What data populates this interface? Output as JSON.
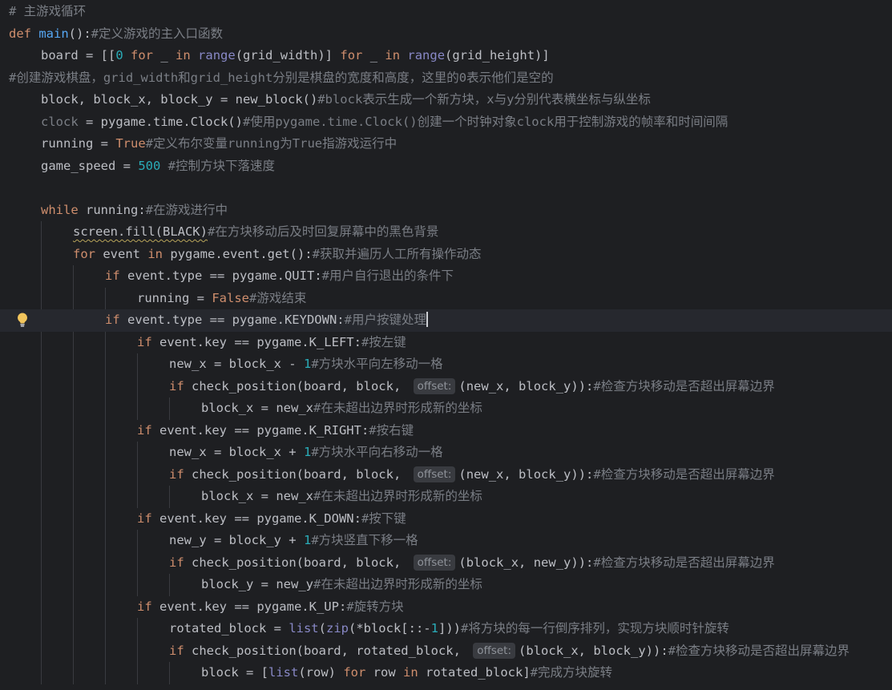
{
  "editor": {
    "theme": {
      "background": "#1e1f22",
      "current_line": "#26282e",
      "default_text": "#bcbec4",
      "comment": "#7a7e85",
      "keyword": "#cf8e6d",
      "function": "#56a8f5",
      "number": "#2aacb8",
      "builtin": "#8888c6",
      "hint_bg": "#393b40"
    },
    "gutter_icon": "lightbulb-icon",
    "lines": [
      {
        "indent": 0,
        "tokens": [
          {
            "t": "# 主游戏循环",
            "c": "cmt"
          }
        ]
      },
      {
        "indent": 0,
        "tokens": [
          {
            "t": "def",
            "c": "kw"
          },
          {
            "t": " "
          },
          {
            "t": "main",
            "c": "fn"
          },
          {
            "t": "():"
          },
          {
            "t": "#定义游戏的主入口函数",
            "c": "cmt"
          }
        ]
      },
      {
        "indent": 1,
        "tokens": [
          {
            "t": "board = [["
          },
          {
            "t": "0",
            "c": "num"
          },
          {
            "t": " "
          },
          {
            "t": "for",
            "c": "kw"
          },
          {
            "t": " _ "
          },
          {
            "t": "in",
            "c": "kw"
          },
          {
            "t": " "
          },
          {
            "t": "range",
            "c": "bi"
          },
          {
            "t": "(grid_width)] "
          },
          {
            "t": "for",
            "c": "kw"
          },
          {
            "t": " _ "
          },
          {
            "t": "in",
            "c": "kw"
          },
          {
            "t": " "
          },
          {
            "t": "range",
            "c": "bi"
          },
          {
            "t": "(grid_height)]"
          }
        ]
      },
      {
        "indent": 0,
        "tokens": [
          {
            "t": "#创建游戏棋盘，grid_width和grid_height分别是棋盘的宽度和高度，这里的0表示他们是空的",
            "c": "cmt"
          }
        ]
      },
      {
        "indent": 1,
        "tokens": [
          {
            "t": "block, block_x, block_y = new_block()"
          },
          {
            "t": "#block表示生成一个新方块，x与y分别代表横坐标与纵坐标",
            "c": "cmt"
          }
        ]
      },
      {
        "indent": 1,
        "tokens": [
          {
            "t": "clock",
            "c": "unused"
          },
          {
            "t": " = pygame.time.Clock()"
          },
          {
            "t": "#使用pygame.time.Clock()创建一个时钟对象clock用于控制游戏的帧率和时间间隔",
            "c": "cmt"
          }
        ]
      },
      {
        "indent": 1,
        "tokens": [
          {
            "t": "running = "
          },
          {
            "t": "True",
            "c": "kw"
          },
          {
            "t": "#定义布尔变量running为True指游戏运行中",
            "c": "cmt"
          }
        ]
      },
      {
        "indent": 1,
        "tokens": [
          {
            "t": "game_speed = "
          },
          {
            "t": "500",
            "c": "num"
          },
          {
            "t": " "
          },
          {
            "t": "#控制方块下落速度",
            "c": "cmt"
          }
        ]
      },
      {
        "indent": 0,
        "tokens": []
      },
      {
        "indent": 1,
        "tokens": [
          {
            "t": "while",
            "c": "kw"
          },
          {
            "t": " running:"
          },
          {
            "t": "#在游戏进行中",
            "c": "cmt"
          }
        ]
      },
      {
        "indent": 2,
        "tokens": [
          {
            "t": "screen.fill(BLACK)",
            "c": "warn"
          },
          {
            "t": "#在方块移动后及时回复屏幕中的黑色背景",
            "c": "cmt"
          }
        ]
      },
      {
        "indent": 2,
        "tokens": [
          {
            "t": "for",
            "c": "kw"
          },
          {
            "t": " event "
          },
          {
            "t": "in",
            "c": "kw"
          },
          {
            "t": " pygame.event.get():"
          },
          {
            "t": "#获取并遍历人工所有操作动态",
            "c": "cmt"
          }
        ]
      },
      {
        "indent": 3,
        "tokens": [
          {
            "t": "if",
            "c": "kw"
          },
          {
            "t": " event.type == pygame.QUIT:"
          },
          {
            "t": "#用户自行退出的条件下",
            "c": "cmt"
          }
        ]
      },
      {
        "indent": 4,
        "tokens": [
          {
            "t": "running = "
          },
          {
            "t": "False",
            "c": "kw"
          },
          {
            "t": "#游戏结束",
            "c": "cmt"
          }
        ]
      },
      {
        "indent": 3,
        "current": true,
        "caret": true,
        "bulb": true,
        "tokens": [
          {
            "t": "if",
            "c": "kw"
          },
          {
            "t": " event.type == pygame.KEYDOWN:"
          },
          {
            "t": "#用户按键处理",
            "c": "cmt"
          }
        ]
      },
      {
        "indent": 4,
        "tokens": [
          {
            "t": "if",
            "c": "kw"
          },
          {
            "t": " event.key == pygame.K_LEFT:"
          },
          {
            "t": "#按左键",
            "c": "cmt"
          }
        ]
      },
      {
        "indent": 5,
        "tokens": [
          {
            "t": "new_x = block_x - "
          },
          {
            "t": "1",
            "c": "num"
          },
          {
            "t": "#方块水平向左移动一格",
            "c": "cmt"
          }
        ]
      },
      {
        "indent": 5,
        "tokens": [
          {
            "t": "if",
            "c": "kw"
          },
          {
            "t": " check_position(board, block, "
          },
          {
            "t": "offset:",
            "c": "hint"
          },
          {
            "t": "(new_x, block_y)):"
          },
          {
            "t": "#检查方块移动是否超出屏幕边界",
            "c": "cmt"
          }
        ]
      },
      {
        "indent": 6,
        "tokens": [
          {
            "t": "block_x = new_x"
          },
          {
            "t": "#在未超出边界时形成新的坐标",
            "c": "cmt"
          }
        ]
      },
      {
        "indent": 4,
        "tokens": [
          {
            "t": "if",
            "c": "kw"
          },
          {
            "t": " event.key == pygame.K_RIGHT:"
          },
          {
            "t": "#按右键",
            "c": "cmt"
          }
        ]
      },
      {
        "indent": 5,
        "tokens": [
          {
            "t": "new_x = block_x + "
          },
          {
            "t": "1",
            "c": "num"
          },
          {
            "t": "#方块水平向右移动一格",
            "c": "cmt"
          }
        ]
      },
      {
        "indent": 5,
        "tokens": [
          {
            "t": "if",
            "c": "kw"
          },
          {
            "t": " check_position(board, block, "
          },
          {
            "t": "offset:",
            "c": "hint"
          },
          {
            "t": "(new_x, block_y)):"
          },
          {
            "t": "#检查方块移动是否超出屏幕边界",
            "c": "cmt"
          }
        ]
      },
      {
        "indent": 6,
        "tokens": [
          {
            "t": "block_x = new_x"
          },
          {
            "t": "#在未超出边界时形成新的坐标",
            "c": "cmt"
          }
        ]
      },
      {
        "indent": 4,
        "tokens": [
          {
            "t": "if",
            "c": "kw"
          },
          {
            "t": " event.key == pygame.K_DOWN:"
          },
          {
            "t": "#按下键",
            "c": "cmt"
          }
        ]
      },
      {
        "indent": 5,
        "tokens": [
          {
            "t": "new_y = block_y + "
          },
          {
            "t": "1",
            "c": "num"
          },
          {
            "t": "#方块竖直下移一格",
            "c": "cmt"
          }
        ]
      },
      {
        "indent": 5,
        "tokens": [
          {
            "t": "if",
            "c": "kw"
          },
          {
            "t": " check_position(board, block, "
          },
          {
            "t": "offset:",
            "c": "hint"
          },
          {
            "t": "(block_x, new_y)):"
          },
          {
            "t": "#检查方块移动是否超出屏幕边界",
            "c": "cmt"
          }
        ]
      },
      {
        "indent": 6,
        "tokens": [
          {
            "t": "block_y = new_y"
          },
          {
            "t": "#在未超出边界时形成新的坐标",
            "c": "cmt"
          }
        ]
      },
      {
        "indent": 4,
        "tokens": [
          {
            "t": "if",
            "c": "kw"
          },
          {
            "t": " event.key == pygame.K_UP:"
          },
          {
            "t": "#旋转方块",
            "c": "cmt"
          }
        ]
      },
      {
        "indent": 5,
        "tokens": [
          {
            "t": "rotated_block = "
          },
          {
            "t": "list",
            "c": "bi"
          },
          {
            "t": "("
          },
          {
            "t": "zip",
            "c": "bi"
          },
          {
            "t": "(*block[::-"
          },
          {
            "t": "1",
            "c": "num"
          },
          {
            "t": "]))"
          },
          {
            "t": "#将方块的每一行倒序排列，实现方块顺时针旋转",
            "c": "cmt"
          }
        ]
      },
      {
        "indent": 5,
        "tokens": [
          {
            "t": "if",
            "c": "kw"
          },
          {
            "t": " check_position(board, rotated_block, "
          },
          {
            "t": "offset:",
            "c": "hint"
          },
          {
            "t": "(block_x, block_y)):"
          },
          {
            "t": "#检查方块移动是否超出屏幕边界",
            "c": "cmt"
          }
        ]
      },
      {
        "indent": 6,
        "tokens": [
          {
            "t": "block = ["
          },
          {
            "t": "list",
            "c": "bi"
          },
          {
            "t": "(row) "
          },
          {
            "t": "for",
            "c": "kw"
          },
          {
            "t": " row "
          },
          {
            "t": "in",
            "c": "kw"
          },
          {
            "t": " rotated_block]"
          },
          {
            "t": "#完成方块旋转",
            "c": "cmt"
          }
        ]
      }
    ]
  }
}
